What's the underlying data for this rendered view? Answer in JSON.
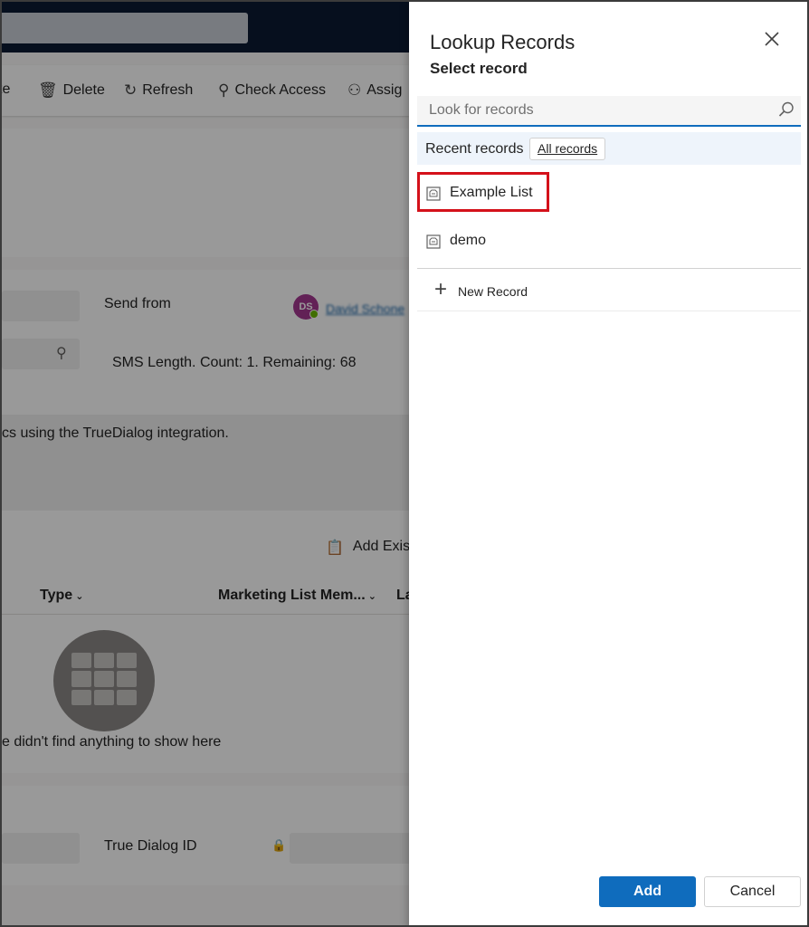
{
  "background": {
    "commands": [
      {
        "label": "te",
        "icon": "edit-icon"
      },
      {
        "label": "Delete",
        "icon": "trash-icon"
      },
      {
        "label": "Refresh",
        "icon": "refresh-icon"
      },
      {
        "label": "Check Access",
        "icon": "key-icon"
      },
      {
        "label": "Assig",
        "icon": "assign-icon"
      }
    ],
    "send_from_label": "Send from",
    "owner_initials": "DS",
    "owner_name": "David Schone",
    "sms_length": "SMS Length. Count: 1. Remaining: 68",
    "description_text": "cs using the TrueDialog integration.",
    "add_existing": "Add Exis",
    "columns": [
      "Type",
      "Marketing List Mem...",
      "La"
    ],
    "empty_message": "e didn't find anything to show here",
    "true_dialog_id_label": "True Dialog ID"
  },
  "panel": {
    "title": "Lookup Records",
    "subtitle": "Select record",
    "search_placeholder": "Look for records",
    "recent_label": "Recent records",
    "all_records_label": "All records",
    "records": [
      {
        "label": "Example List",
        "highlighted": true
      },
      {
        "label": "demo",
        "highlighted": false
      }
    ],
    "new_record_label": "New Record",
    "add_label": "Add",
    "cancel_label": "Cancel"
  },
  "colors": {
    "accent": "#0f6cbd",
    "highlight_border": "#d4111a",
    "topbar": "#0b1a33"
  }
}
